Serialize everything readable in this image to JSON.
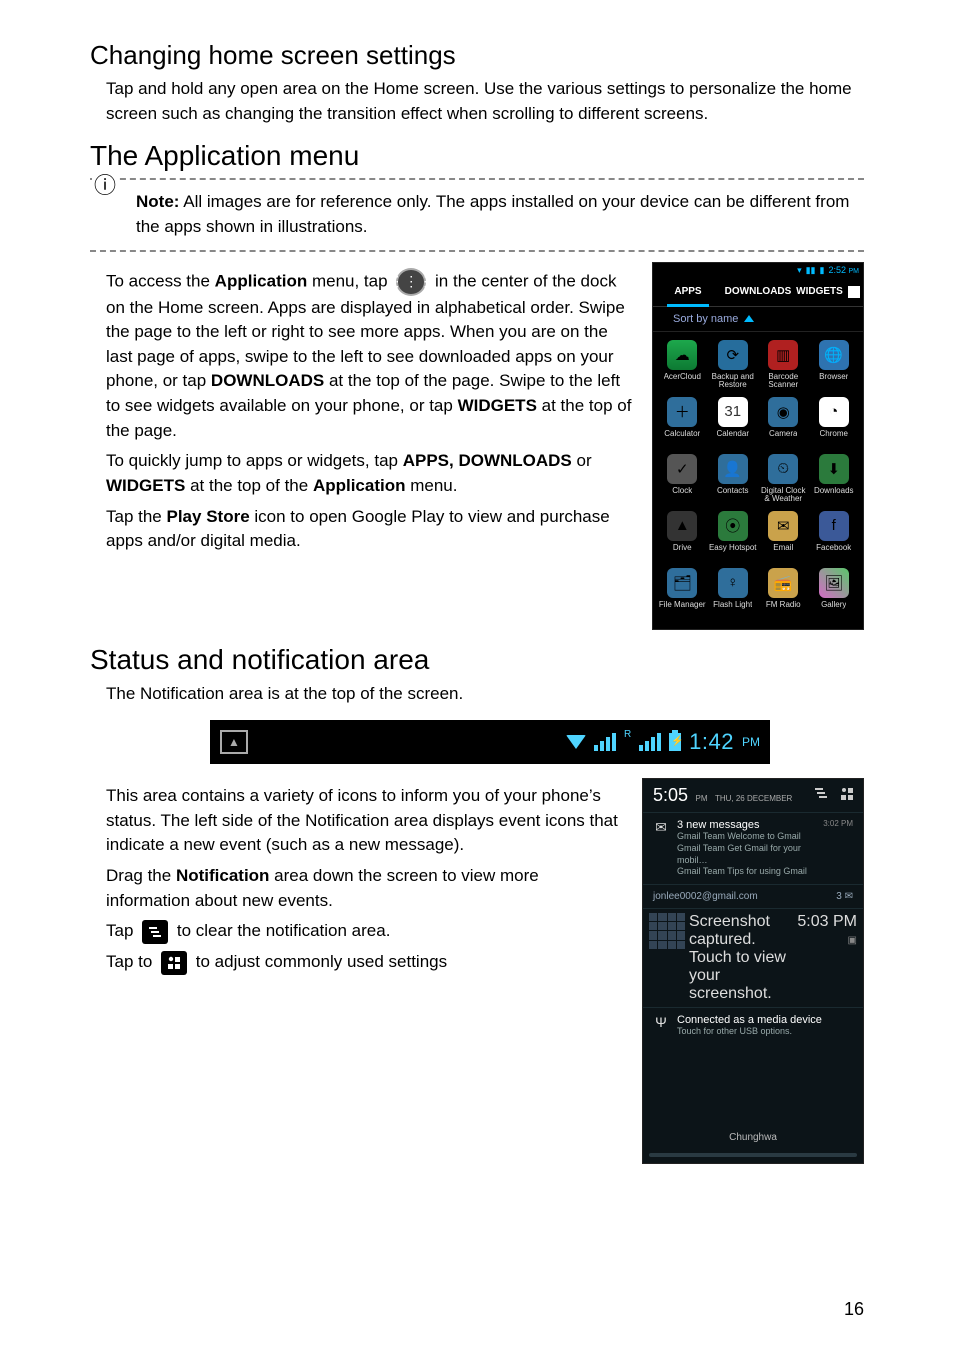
{
  "section_changing_title": "Changing home screen settings",
  "section_changing_body": "Tap and hold any open area on the Home screen. Use the various settings to personalize the home screen such as changing the transition effect when scrolling to different screens.",
  "section_appmenu_title": "The Application menu",
  "note_label": "Note:",
  "note_body": " All images are for reference only. The apps installed on your device can be different from the apps shown in illustrations.",
  "appmenu_p1_a": "To access the ",
  "appmenu_p1_b": "Application",
  "appmenu_p1_c": " menu, tap ",
  "appmenu_p1_d": " in the center of the dock on the Home screen. Apps are displayed in alphabetical order. Swipe the page to the left or right to see more apps. When you are on the last page of apps, swipe to the left to see downloaded apps on your phone, or tap ",
  "appmenu_p1_e": "DOWNLOADS",
  "appmenu_p1_f": " at the top of the page. Swipe to the left to see widgets available on your phone, or tap ",
  "appmenu_p1_g": "WIDGETS",
  "appmenu_p1_h": " at the top of the page.",
  "appmenu_p2_a": "To quickly jump to apps or widgets, tap ",
  "appmenu_p2_b": "APPS, DOWNLOADS",
  "appmenu_p2_c": " or ",
  "appmenu_p2_d": "WIDGETS",
  "appmenu_p2_e": " at the top of the ",
  "appmenu_p2_f": "Application",
  "appmenu_p2_g": " menu.",
  "appmenu_p3_a": "Tap the ",
  "appmenu_p3_b": "Play Store",
  "appmenu_p3_c": " icon to open Google Play to view and purchase apps and/or digital media.",
  "section_status_title": "Status and notification area",
  "status_p1": "The Notification area is at the top of the screen.",
  "status_p2": "This area contains a variety of icons to inform you of your phone’s status. The left side of the Notification area displays event icons that indicate a new event (such as a new message).",
  "status_p3_a": "Drag the ",
  "status_p3_b": "Notification",
  "status_p3_c": " area down the screen to view more information about new events.",
  "status_p4_a": "Tap ",
  "status_p4_b": " to clear the notification area.",
  "status_p5_a": "Tap to ",
  "status_p5_b": " to adjust commonly used settings",
  "page_number": "16",
  "phone_shot": {
    "status_time": "2:52",
    "status_pm": "PM",
    "tabs": [
      "APPS",
      "DOWNLOADS",
      "WIDGETS"
    ],
    "sort_label": "Sort by name",
    "apps": [
      {
        "label": "AcerCloud",
        "glyph": "☁",
        "cls": "c-acercloud"
      },
      {
        "label": "Backup and Restore",
        "glyph": "⟳",
        "cls": "c-backup"
      },
      {
        "label": "Barcode Scanner",
        "glyph": "▥",
        "cls": "c-barcode"
      },
      {
        "label": "Browser",
        "glyph": "🌐",
        "cls": "c-browser"
      },
      {
        "label": "Calculator",
        "glyph": "＋",
        "cls": "c-calculator"
      },
      {
        "label": "Calendar",
        "glyph": "31",
        "cls": "c-calendar"
      },
      {
        "label": "Camera",
        "glyph": "◉",
        "cls": "c-camera"
      },
      {
        "label": "Chrome",
        "glyph": "◔",
        "cls": "c-chrome"
      },
      {
        "label": "Clock",
        "glyph": "✓",
        "cls": "c-clock"
      },
      {
        "label": "Contacts",
        "glyph": "👤",
        "cls": "c-contacts"
      },
      {
        "label": "Digital Clock & Weather",
        "glyph": "⏲",
        "cls": "c-digitalclock"
      },
      {
        "label": "Downloads",
        "glyph": "⬇",
        "cls": "c-downloads"
      },
      {
        "label": "Drive",
        "glyph": "▲",
        "cls": "c-drive"
      },
      {
        "label": "Easy Hotspot",
        "glyph": "⦿",
        "cls": "c-easyhotspot"
      },
      {
        "label": "Email",
        "glyph": "✉",
        "cls": "c-email"
      },
      {
        "label": "Facebook",
        "glyph": "f",
        "cls": "c-facebook"
      },
      {
        "label": "File Manager",
        "glyph": "🗂",
        "cls": "c-filemanager"
      },
      {
        "label": "Flash Light",
        "glyph": "♀",
        "cls": "c-flashlight"
      },
      {
        "label": "FM Radio",
        "glyph": "📻",
        "cls": "c-fmradio"
      },
      {
        "label": "Gallery",
        "glyph": "🖼",
        "cls": "c-gallery"
      }
    ]
  },
  "statusbar": {
    "time": "1:42",
    "pm": "PM"
  },
  "drawer": {
    "time": "5:05",
    "pm": "PM",
    "date": "THU, 26 DECEMBER",
    "msgs_title": "3 new messages",
    "msgs_time": "3:02 PM",
    "msgs_lines": [
      "Gmail Team Welcome to Gmail",
      "Gmail Team Get Gmail for your mobil…",
      "Gmail Team Tips for using Gmail"
    ],
    "account": "jonlee0002@gmail.com",
    "account_count": "3",
    "ss_title": "Screenshot captured.",
    "ss_sub": "Touch to view your screenshot.",
    "ss_time": "5:03 PM",
    "usb_title": "Connected as a media device",
    "usb_sub": "Touch for other USB options.",
    "carrier": "Chunghwa"
  }
}
